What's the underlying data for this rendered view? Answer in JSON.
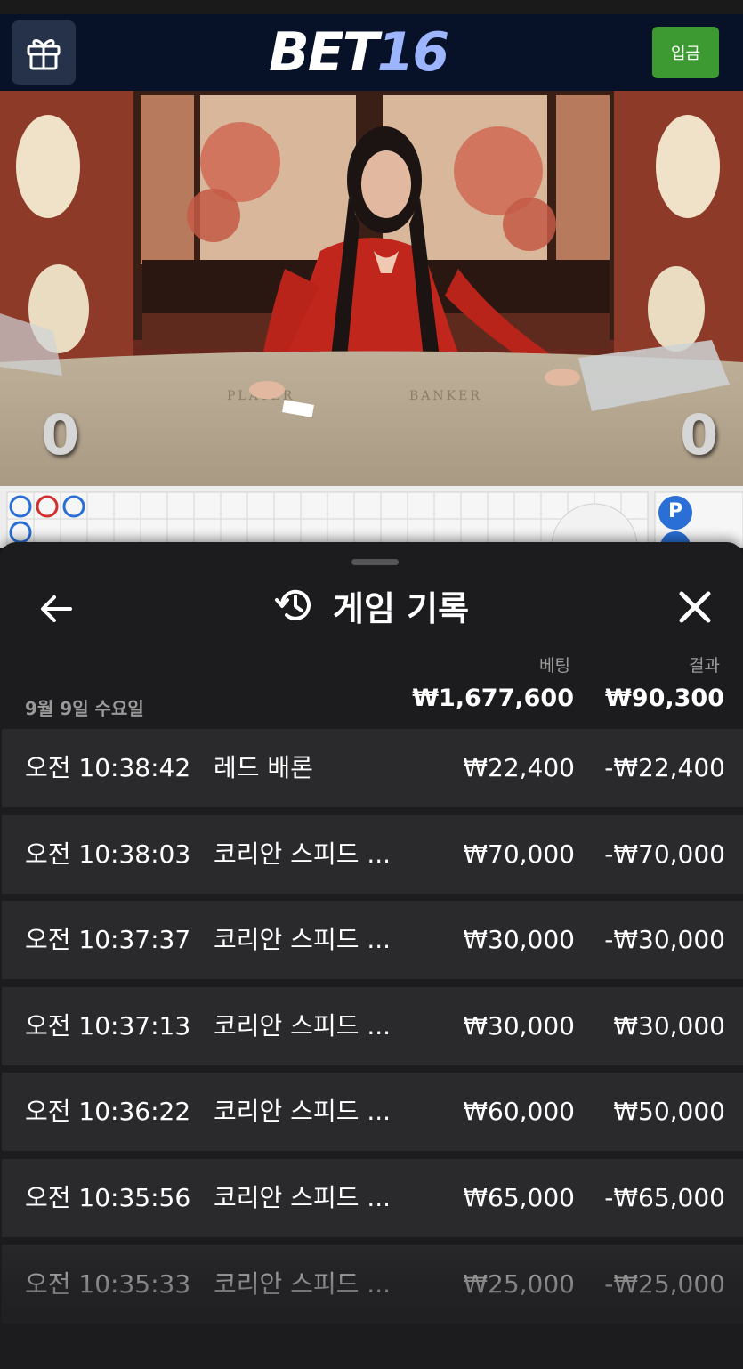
{
  "header": {
    "logo_main": "BET",
    "logo_num": "16",
    "deposit_label": "입금",
    "gift_icon": "gift-icon"
  },
  "video": {
    "table_player_label": "PLAYER",
    "table_banker_label": "BANKER",
    "player_score": "0",
    "banker_score": "0"
  },
  "roadmap": {
    "p_badge": "P"
  },
  "sheet": {
    "title": "게임 기록",
    "columns": {
      "bet": "베팅",
      "result": "결과"
    },
    "date": "9월 9일 수요일",
    "total_bet": "₩1,677,600",
    "total_result": "₩90,300",
    "rows": [
      {
        "time": "오전 10:38:42",
        "game": "레드 배론",
        "bet": "₩22,400",
        "result": "-₩22,400"
      },
      {
        "time": "오전 10:38:03",
        "game": "코리안 스피드 ...",
        "bet": "₩70,000",
        "result": "-₩70,000"
      },
      {
        "time": "오전 10:37:37",
        "game": "코리안 스피드 ...",
        "bet": "₩30,000",
        "result": "-₩30,000"
      },
      {
        "time": "오전 10:37:13",
        "game": "코리안 스피드 ...",
        "bet": "₩30,000",
        "result": "₩30,000"
      },
      {
        "time": "오전 10:36:22",
        "game": "코리안 스피드 ...",
        "bet": "₩60,000",
        "result": "₩50,000"
      },
      {
        "time": "오전 10:35:56",
        "game": "코리안 스피드 ...",
        "bet": "₩65,000",
        "result": "-₩65,000"
      },
      {
        "time": "오전 10:35:33",
        "game": "코리안 스피드 ...",
        "bet": "₩25,000",
        "result": "-₩25,000"
      }
    ]
  },
  "colors": {
    "header_bg": "#071229",
    "deposit_green": "#3d9a33",
    "sheet_bg": "#1c1c1e",
    "row_bg": "#2a2a2c"
  }
}
